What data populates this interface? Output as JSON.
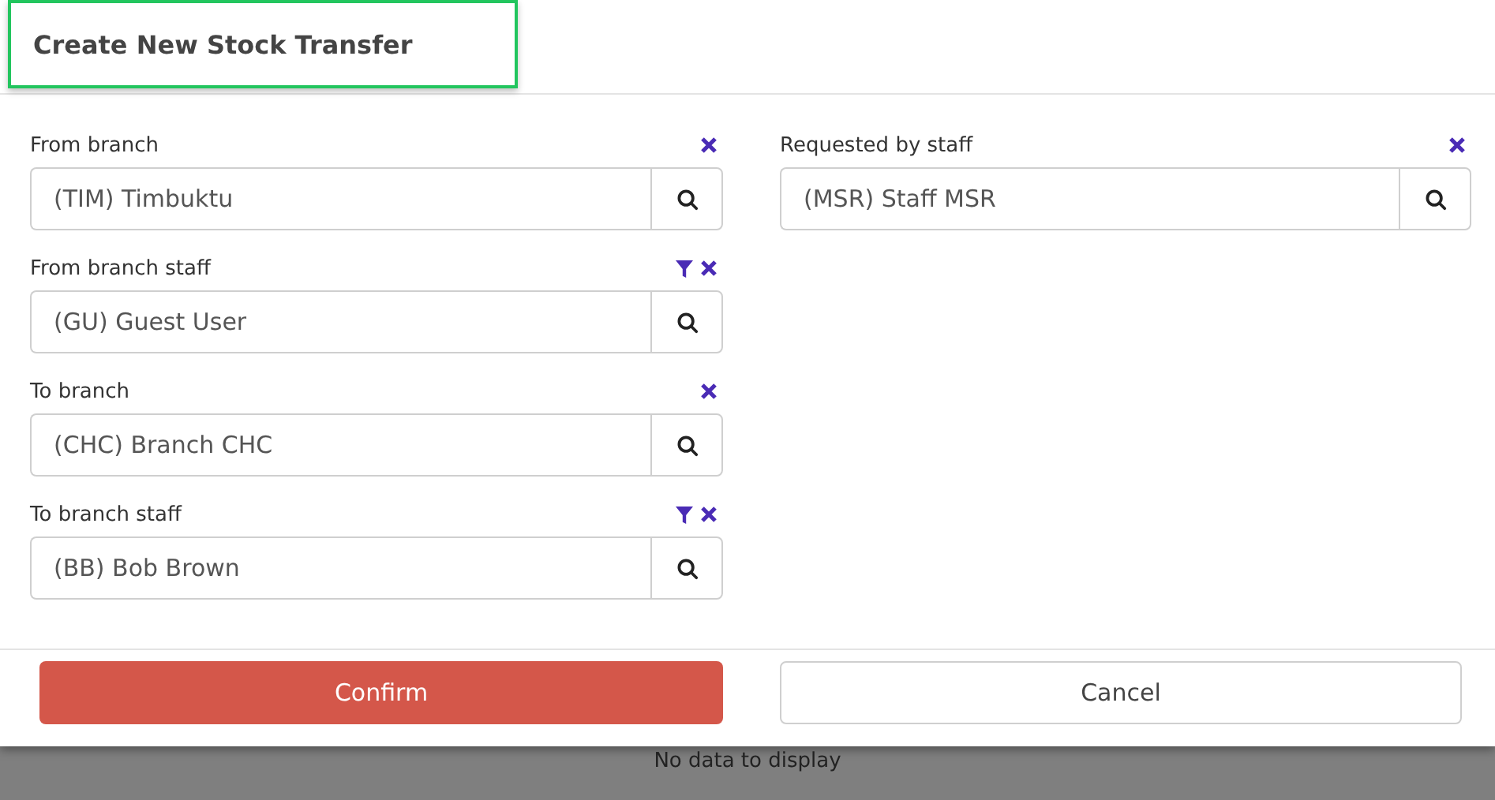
{
  "dialog": {
    "title": "Create New Stock Transfer",
    "title_highlighted": true
  },
  "columns": [
    {
      "fields": [
        {
          "label": "From branch",
          "value": "(TIM) Timbuktu",
          "filter": false,
          "clear": true
        },
        {
          "label": "From branch staff",
          "value": "(GU) Guest User",
          "filter": true,
          "clear": true
        },
        {
          "label": "To branch",
          "value": "(CHC) Branch CHC",
          "filter": false,
          "clear": true
        },
        {
          "label": "To branch staff",
          "value": "(BB) Bob Brown",
          "filter": true,
          "clear": true
        }
      ]
    },
    {
      "fields": [
        {
          "label": "Requested by staff",
          "value": "(MSR) Staff MSR",
          "filter": false,
          "clear": true
        }
      ]
    }
  ],
  "buttons": [
    {
      "label": "Confirm",
      "kind": "primary"
    },
    {
      "label": "Cancel",
      "kind": "secondary"
    }
  ],
  "background": {
    "empty_message": "No data to display"
  }
}
